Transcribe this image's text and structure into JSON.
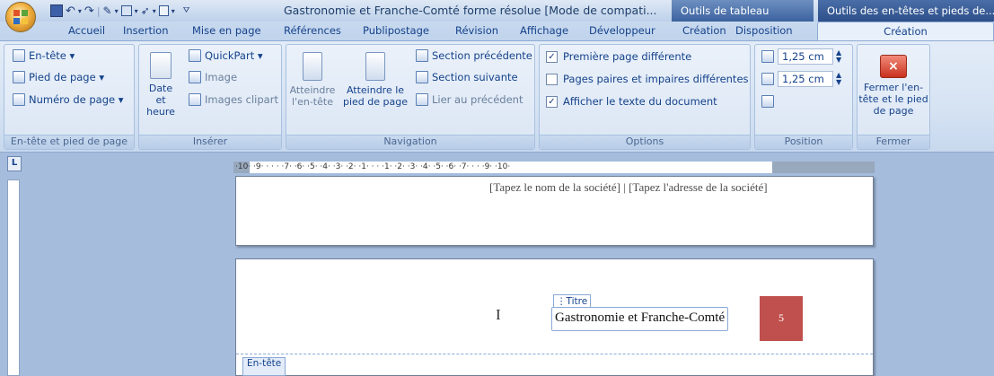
{
  "window": {
    "title": "Gastronomie et Franche-Comté forme résolue [Mode de compati...",
    "contextual_tabs": [
      "Outils de tableau",
      "Outils des en-têtes et pieds de..."
    ]
  },
  "tabs": [
    "Accueil",
    "Insertion",
    "Mise en page",
    "Références",
    "Publipostage",
    "Révision",
    "Affichage",
    "Développeur",
    "Création",
    "Disposition",
    "Création"
  ],
  "ribbon": {
    "groups": {
      "header_footer": {
        "label": "En-tête et pied de page",
        "items": [
          "En-tête ▾",
          "Pied de page ▾",
          "Numéro de page ▾"
        ]
      },
      "insert": {
        "label": "Insérer",
        "date_time": "Date et heure",
        "items": [
          "QuickPart ▾",
          "Image",
          "Images clipart"
        ]
      },
      "navigation": {
        "label": "Navigation",
        "goto_header": "Atteindre l'en-tête",
        "goto_footer": "Atteindre le pied de page",
        "items": [
          "Section précédente",
          "Section suivante",
          "Lier au précédent"
        ]
      },
      "options": {
        "label": "Options",
        "items": [
          {
            "label": "Première page différente",
            "checked": "✓"
          },
          {
            "label": "Pages paires et impaires différentes",
            "checked": ""
          },
          {
            "label": "Afficher le texte du document",
            "checked": "✓"
          }
        ]
      },
      "position": {
        "label": "Position",
        "header_pos": "1,25 cm",
        "footer_pos": "1,25 cm"
      },
      "close": {
        "label": "Fermer",
        "button": "Fermer l'en-tête et le pied de page"
      }
    }
  },
  "ruler": {
    "corner": "L",
    "ticks": "·10· ·9· · ·  · ·7· ·6· ·5· ·4· ·3· ·2· ·1· ·  · ·1· ·2· ·3· ·4· ·5· ·6·  ·7· ·  · ·9· ·10·"
  },
  "document": {
    "company_placeholder": "[Tapez le nom de la société] | [Tapez l'adresse de la société]",
    "title_tag": "⋮Titre",
    "title_value": "Gastronomie et Franche-Comté",
    "page_number": "5",
    "header_tag": "En-tête",
    "cursor": "I"
  },
  "colors": {
    "ribbon_text": "#15428b",
    "page_number_bg": "#c0504d",
    "contextual_tab": "#3c62a0"
  }
}
